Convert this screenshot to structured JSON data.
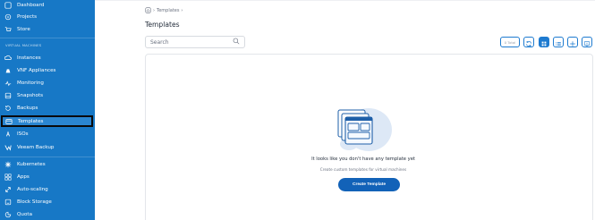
{
  "sidebar": {
    "top_items": [
      {
        "label": "Dashboard",
        "icon": "dashboard-icon"
      },
      {
        "label": "Projects",
        "icon": "projects-icon"
      },
      {
        "label": "Store",
        "icon": "store-icon"
      }
    ],
    "section_label": "VIRTUAL MACHINES",
    "vm_items": [
      {
        "label": "Instances",
        "icon": "instances-icon"
      },
      {
        "label": "VNF Appliances",
        "icon": "vnf-icon"
      },
      {
        "label": "Monitoring",
        "icon": "monitoring-icon"
      },
      {
        "label": "Snapshots",
        "icon": "snapshots-icon"
      },
      {
        "label": "Backups",
        "icon": "backups-icon"
      },
      {
        "label": "Templates",
        "icon": "templates-icon"
      },
      {
        "label": "ISOs",
        "icon": "iso-icon"
      },
      {
        "label": "Veeam Backup",
        "icon": "veeam-icon"
      }
    ],
    "bottom_items": [
      {
        "label": "Kubernetes",
        "icon": "kubernetes-icon"
      },
      {
        "label": "Apps",
        "icon": "apps-icon"
      },
      {
        "label": "Auto-scaling",
        "icon": "autoscaling-icon"
      },
      {
        "label": "Block Storage",
        "icon": "block-storage-icon"
      },
      {
        "label": "Quota",
        "icon": "quota-icon"
      }
    ],
    "active_label": "Templates"
  },
  "breadcrumb": {
    "current": "Templates",
    "separator": "›"
  },
  "page": {
    "title": "Templates"
  },
  "search": {
    "placeholder": "Search"
  },
  "toolbar": {
    "total_label": "0 Total"
  },
  "empty_state": {
    "title": "It looks like you don't have any template yet",
    "subtitle": "Create custom templates for virtual machines",
    "button_label": "Create Template"
  },
  "colors": {
    "sidebar_bg": "#1778c6",
    "accent": "#1e7bd0",
    "button_bg": "#1262b8"
  }
}
